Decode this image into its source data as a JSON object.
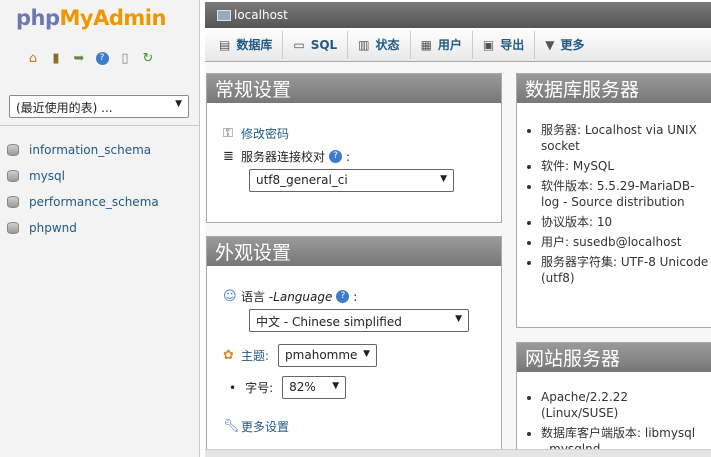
{
  "nav": {
    "logo_php": "php",
    "logo_myadmin": "MyAdmin",
    "quick_icons": [
      "home-icon",
      "logout-icon",
      "query-window-icon",
      "help-icon",
      "docs-icon",
      "reload-icon"
    ],
    "table_select": "(最近使用的表) ...",
    "databases": [
      "information_schema",
      "mysql",
      "performance_schema",
      "phpwnd"
    ]
  },
  "topbar": {
    "server": "localhost"
  },
  "tabs": [
    {
      "label": "数据库",
      "icon": "database-icon"
    },
    {
      "label": "SQL",
      "icon": "sql-icon"
    },
    {
      "label": "状态",
      "icon": "status-icon"
    },
    {
      "label": "用户",
      "icon": "users-icon"
    },
    {
      "label": "导出",
      "icon": "export-icon"
    },
    {
      "label": "更多",
      "icon": "more-icon"
    }
  ],
  "general": {
    "title": "常规设置",
    "change_password": "修改密码",
    "collation_label": "服务器连接校对",
    "collation_value": "utf8_general_ci"
  },
  "appearance": {
    "title": "外观设置",
    "language_label": "语言 - ",
    "language_word": "Language",
    "language_value": "中文 - Chinese simplified",
    "theme_label": "主题:",
    "theme_value": "pmahomme",
    "fontsize_label": "字号:",
    "fontsize_value": "82%",
    "more_settings": "更多设置"
  },
  "db_server": {
    "title": "数据库服务器",
    "items": [
      "服务器: Localhost via UNIX socket",
      "软件: MySQL",
      "软件版本: 5.5.29-MariaDB-log - Source distribution",
      "协议版本: 10",
      "用户: susedb@localhost",
      "服务器字符集: UTF-8 Unicode (utf8)"
    ]
  },
  "web_server": {
    "title": "网站服务器",
    "items": [
      "Apache/2.2.22 (Linux/SUSE)",
      "数据库客户端版本: libmysql - mysqlnd"
    ]
  }
}
